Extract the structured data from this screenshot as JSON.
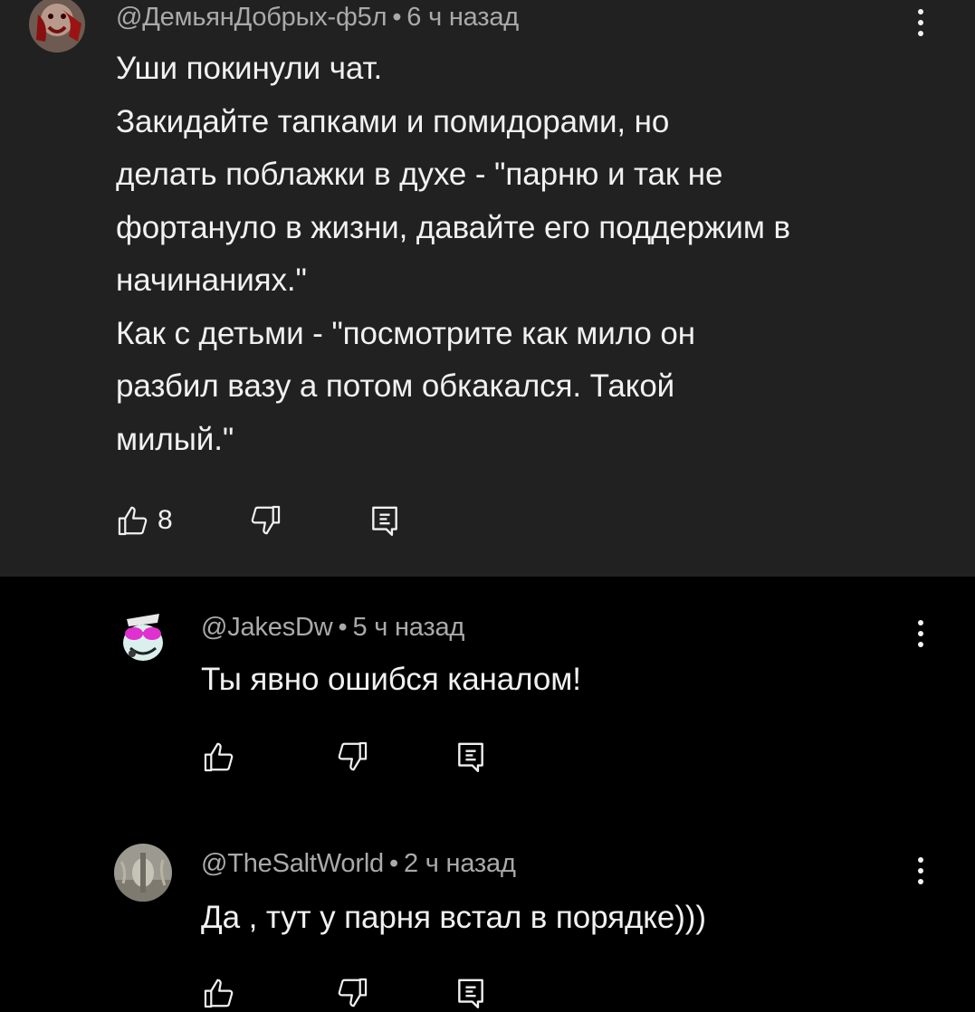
{
  "colors": {
    "background": "#000000",
    "highlight_background": "#212121",
    "text_primary": "#f1f1f1",
    "text_secondary": "#aaaaaa"
  },
  "comments": [
    {
      "author": "@ДемьянДобрых-ф5л",
      "separator": "•",
      "time": "6 ч назад",
      "text": "Уши покинули чат.\nЗакидайте тапками и помидорами, но\nделать поблажки в духе - \"парню и так не\nфортануло в жизни, давайте его поддержим в\nначинаниях.\"\nКак с детьми - \"посмотрите как мило он\nразбил вазу а потом обкакался. Такой\nмилый.\"",
      "likes": "8",
      "icons": {
        "like": "thumbs-up-icon",
        "dislike": "thumbs-down-icon",
        "reply": "reply-comment-icon",
        "menu": "more-vertical-icon"
      }
    },
    {
      "author": "@JakesDw",
      "separator": "•",
      "time": "5 ч назад",
      "text": "Ты явно ошибся каналом!",
      "likes": "",
      "icons": {
        "like": "thumbs-up-icon",
        "dislike": "thumbs-down-icon",
        "reply": "reply-comment-icon",
        "menu": "more-vertical-icon"
      }
    },
    {
      "author": "@TheSaltWorld",
      "separator": "•",
      "time": "2 ч назад",
      "text": "Да , тут у парня встал в порядке)))",
      "likes": "",
      "icons": {
        "like": "thumbs-up-icon",
        "dislike": "thumbs-down-icon",
        "reply": "reply-comment-icon",
        "menu": "more-vertical-icon"
      }
    }
  ]
}
